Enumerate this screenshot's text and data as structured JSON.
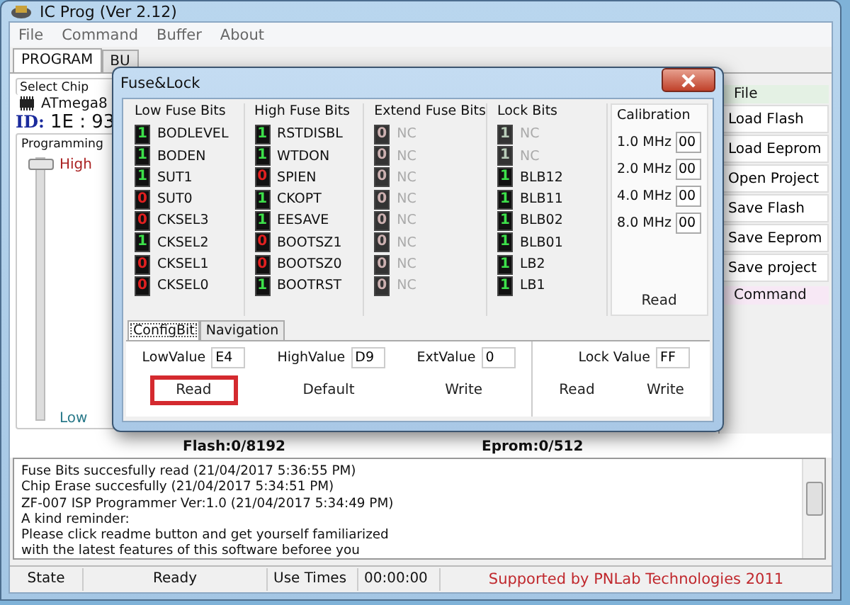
{
  "window": {
    "title": "IC Prog (Ver 2.12)"
  },
  "menu": [
    "File",
    "Command",
    "Buffer",
    "About"
  ],
  "tabs": [
    {
      "label": "PROGRAM",
      "selected": true
    },
    {
      "label": "BU",
      "selected": false
    }
  ],
  "chip": {
    "group": "Select Chip",
    "name": "ATmega8",
    "id_label": "ID:",
    "id_value": "1E : 93"
  },
  "programming": {
    "group": "Programming",
    "high": "High",
    "low": "Low",
    "level": 1
  },
  "memory": {
    "flash": "Flash:0/8192",
    "eprom": "Eprom:0/512"
  },
  "log": [
    "Fuse Bits succesfully read (21/04/2017 5:36:55 PM)",
    "Chip Erase succesfully (21/04/2017 5:34:51 PM)",
    "ZF-007 ISP Programmer Ver:1.0 (21/04/2017 5:34:49 PM)",
    "A kind reminder:",
    "Please click readme button and get yourself familiarized",
    "with the latest features of this software beforee you"
  ],
  "status_bar": {
    "state_label": "State",
    "state": "Ready",
    "use_label": "Use Times",
    "use": "00:00:00",
    "credit": "Supported by PNLab Technologies 2011"
  },
  "side_panel": {
    "file_header": "File",
    "buttons": [
      "Load Flash",
      "Load Eeprom",
      "Open Project",
      "Save Flash",
      "Save Eeprom",
      "Save project"
    ],
    "command_header": "Command"
  },
  "dialog": {
    "title": "Fuse&Lock",
    "groups": [
      {
        "title": "Low Fuse Bits",
        "bits": [
          {
            "value": "1",
            "on": true,
            "name": "BODLEVEL",
            "disabled": false
          },
          {
            "value": "1",
            "on": true,
            "name": "BODEN",
            "disabled": false
          },
          {
            "value": "1",
            "on": true,
            "name": "SUT1",
            "disabled": false
          },
          {
            "value": "0",
            "on": false,
            "name": "SUT0",
            "disabled": false
          },
          {
            "value": "0",
            "on": false,
            "name": "CKSEL3",
            "disabled": false
          },
          {
            "value": "1",
            "on": true,
            "name": "CKSEL2",
            "disabled": false
          },
          {
            "value": "0",
            "on": false,
            "name": "CKSEL1",
            "disabled": false
          },
          {
            "value": "0",
            "on": false,
            "name": "CKSEL0",
            "disabled": false
          }
        ]
      },
      {
        "title": "High Fuse Bits",
        "bits": [
          {
            "value": "1",
            "on": true,
            "name": "RSTDISBL",
            "disabled": false
          },
          {
            "value": "1",
            "on": true,
            "name": "WTDON",
            "disabled": false
          },
          {
            "value": "0",
            "on": false,
            "name": "SPIEN",
            "disabled": false
          },
          {
            "value": "1",
            "on": true,
            "name": "CKOPT",
            "disabled": false
          },
          {
            "value": "1",
            "on": true,
            "name": "EESAVE",
            "disabled": false
          },
          {
            "value": "0",
            "on": false,
            "name": "BOOTSZ1",
            "disabled": false
          },
          {
            "value": "0",
            "on": false,
            "name": "BOOTSZ0",
            "disabled": false
          },
          {
            "value": "1",
            "on": true,
            "name": "BOOTRST",
            "disabled": false
          }
        ]
      },
      {
        "title": "Extend Fuse Bits",
        "bits": [
          {
            "value": "0",
            "on": false,
            "name": "NC",
            "disabled": true
          },
          {
            "value": "0",
            "on": false,
            "name": "NC",
            "disabled": true
          },
          {
            "value": "0",
            "on": false,
            "name": "NC",
            "disabled": true
          },
          {
            "value": "0",
            "on": false,
            "name": "NC",
            "disabled": true
          },
          {
            "value": "0",
            "on": false,
            "name": "NC",
            "disabled": true
          },
          {
            "value": "0",
            "on": false,
            "name": "NC",
            "disabled": true
          },
          {
            "value": "0",
            "on": false,
            "name": "NC",
            "disabled": true
          },
          {
            "value": "0",
            "on": false,
            "name": "NC",
            "disabled": true
          }
        ]
      },
      {
        "title": "Lock Bits",
        "bits": [
          {
            "value": "1",
            "on": true,
            "name": "NC",
            "disabled": true
          },
          {
            "value": "1",
            "on": true,
            "name": "NC",
            "disabled": true
          },
          {
            "value": "1",
            "on": true,
            "name": "BLB12",
            "disabled": false
          },
          {
            "value": "1",
            "on": true,
            "name": "BLB11",
            "disabled": false
          },
          {
            "value": "1",
            "on": true,
            "name": "BLB02",
            "disabled": false
          },
          {
            "value": "1",
            "on": true,
            "name": "BLB01",
            "disabled": false
          },
          {
            "value": "1",
            "on": true,
            "name": "LB2",
            "disabled": false
          },
          {
            "value": "1",
            "on": true,
            "name": "LB1",
            "disabled": false
          }
        ]
      }
    ],
    "calibration": {
      "title": "Calibration",
      "rows": [
        {
          "label": "1.0 MHz",
          "value": "00"
        },
        {
          "label": "2.0 MHz",
          "value": "00"
        },
        {
          "label": "4.0 MHz",
          "value": "00"
        },
        {
          "label": "8.0 MHz",
          "value": "00"
        }
      ],
      "button": "Read"
    },
    "tabs": [
      {
        "label": "ConfigBit",
        "selected": true
      },
      {
        "label": "Navigation",
        "selected": false
      }
    ],
    "fields": [
      {
        "label": "LowValue",
        "value": "E4"
      },
      {
        "label": "HighValue",
        "value": "D9"
      },
      {
        "label": "ExtValue",
        "value": "0"
      }
    ],
    "fuse_buttons": [
      {
        "label": "Read",
        "highlighted": true
      },
      {
        "label": "Default",
        "highlighted": false
      },
      {
        "label": "Write",
        "highlighted": false
      }
    ],
    "lock_field": {
      "label": "Lock Value",
      "value": "FF"
    },
    "lock_buttons": [
      {
        "label": "Read",
        "highlighted": false
      },
      {
        "label": "Write",
        "highlighted": false
      }
    ]
  }
}
